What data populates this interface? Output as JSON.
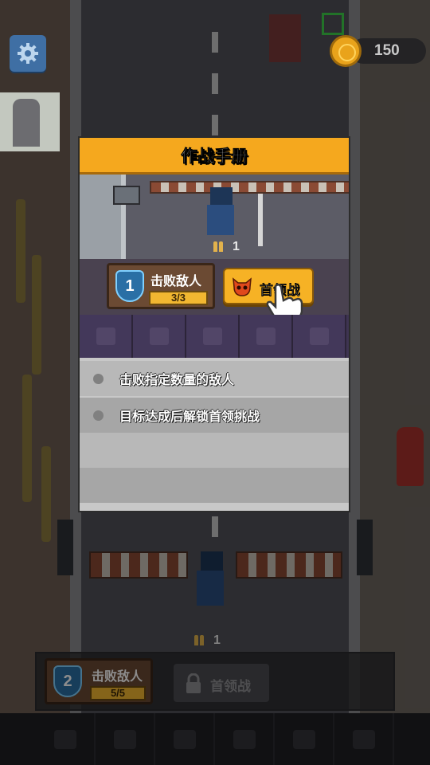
{
  "hud": {
    "coins": "150"
  },
  "dialog": {
    "title": "作战手册",
    "preview": {
      "ammo_count": "1",
      "task": {
        "level": "1",
        "title": "击败敌人",
        "progress": "3/3"
      },
      "boss_button_label": "首领战"
    },
    "rules": [
      "击败指定数量的敌人",
      "目标达成后解锁首领挑战"
    ]
  },
  "game": {
    "ammo_count": "1",
    "task": {
      "level": "2",
      "title": "击败敌人",
      "progress": "5/5"
    },
    "boss_button_label": "首领战"
  },
  "colors": {
    "header_orange": "#f5a81e",
    "progress_yellow": "#f2b731",
    "shield_blue": "#2a6fa5"
  }
}
